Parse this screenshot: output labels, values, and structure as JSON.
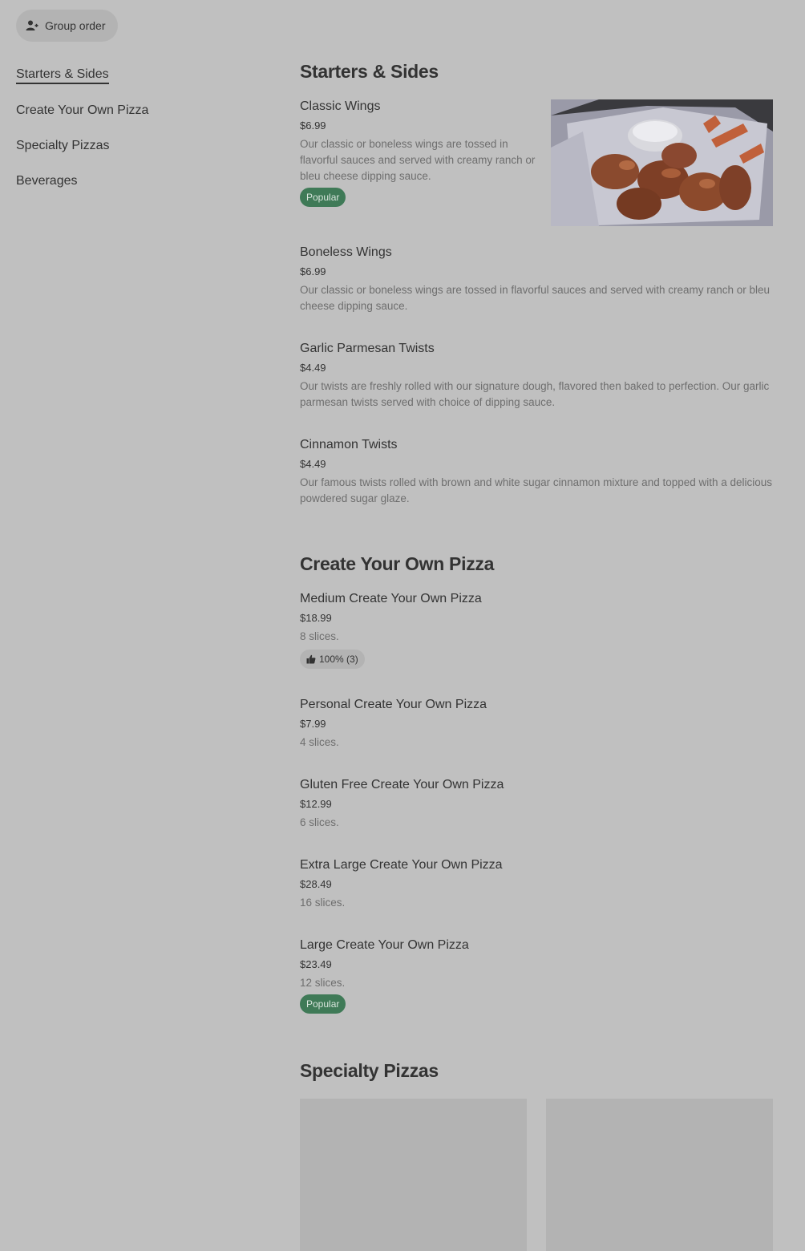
{
  "header": {
    "group_order_label": "Group order"
  },
  "sidebar": {
    "items": [
      {
        "label": "Starters & Sides"
      },
      {
        "label": "Create Your Own Pizza"
      },
      {
        "label": "Specialty Pizzas"
      },
      {
        "label": "Beverages"
      }
    ]
  },
  "sections": {
    "starters": {
      "title": "Starters & Sides",
      "items": [
        {
          "name": "Classic Wings",
          "price": "$6.99",
          "desc": "Our classic or boneless wings are tossed in flavorful sauces and served with creamy ranch or bleu cheese dipping sauce.",
          "badge": "Popular"
        },
        {
          "name": "Boneless Wings",
          "price": "$6.99",
          "desc": "Our classic or boneless wings are tossed in flavorful sauces and served with creamy ranch or bleu cheese dipping sauce."
        },
        {
          "name": "Garlic Parmesan Twists",
          "price": "$4.49",
          "desc": "Our twists are freshly rolled with our signature dough, flavored then baked to perfection. Our garlic parmesan twists served with choice of dipping sauce."
        },
        {
          "name": "Cinnamon Twists",
          "price": "$4.49",
          "desc": "Our famous twists rolled with brown and white sugar cinnamon mixture and topped with a delicious powdered sugar glaze."
        }
      ]
    },
    "cyop": {
      "title": "Create Your Own Pizza",
      "items": [
        {
          "name": "Medium Create Your Own Pizza",
          "price": "$18.99",
          "desc": "8 slices.",
          "rating": "100% (3)"
        },
        {
          "name": "Personal Create Your Own Pizza",
          "price": "$7.99",
          "desc": "4 slices."
        },
        {
          "name": "Gluten Free Create Your Own Pizza",
          "price": "$12.99",
          "desc": "6 slices."
        },
        {
          "name": "Extra Large Create Your Own Pizza",
          "price": "$28.49",
          "desc": "16 slices."
        },
        {
          "name": "Large Create Your Own Pizza",
          "price": "$23.49",
          "desc": "12 slices.",
          "badge": "Popular"
        }
      ]
    },
    "specialty": {
      "title": "Specialty Pizzas"
    }
  },
  "colors": {
    "background": "#c0c0c0",
    "popular_badge": "#3f7a57",
    "text_primary": "#333333",
    "text_secondary": "#6e6e6e"
  },
  "icons": {
    "group_order": "person-plus-icon",
    "rating": "thumbs-up-icon"
  }
}
